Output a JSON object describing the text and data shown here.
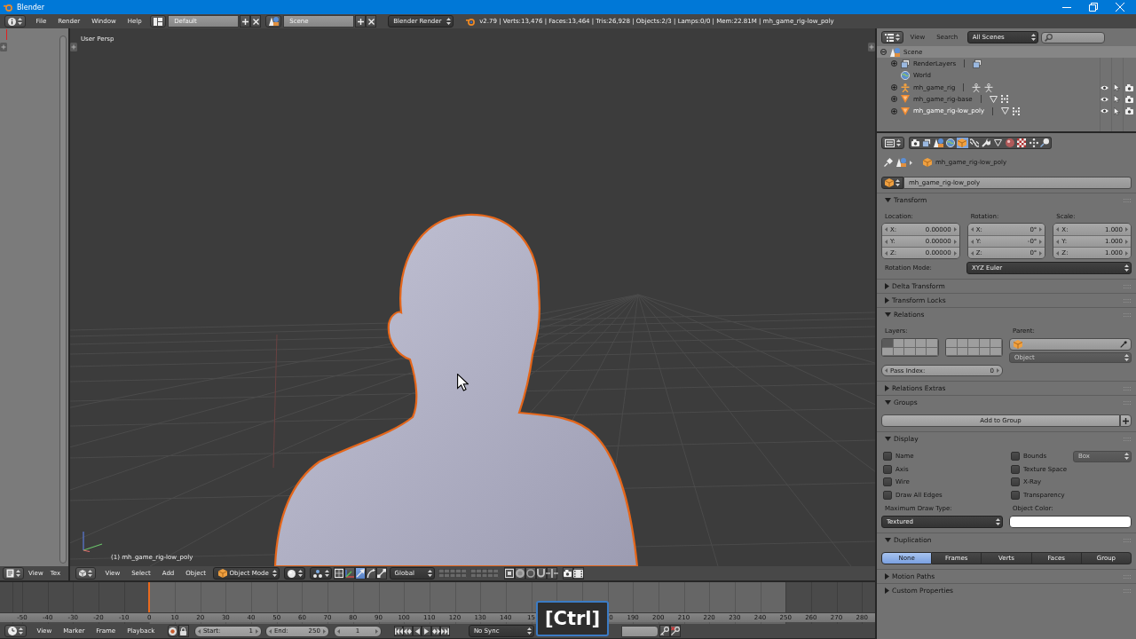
{
  "window": {
    "title": "Blender"
  },
  "info_header": {
    "menus": [
      "File",
      "Render",
      "Window",
      "Help"
    ],
    "layout": "Default",
    "scene": "Scene",
    "engine": "Blender Render",
    "stats": "v2.79 | Verts:13,476 | Faces:13,464 | Tris:26,928 | Objects:2/3 | Lamps:0/0 | Mem:22.81M | mh_game_rig-low_poly"
  },
  "text_editor": {
    "menus": [
      "View",
      "Tex"
    ]
  },
  "viewport": {
    "view_label": "User Persp",
    "object_label": "(1) mh_game_rig-low_poly",
    "menus": [
      "View",
      "Select",
      "Add",
      "Object"
    ],
    "mode": "Object Mode",
    "transform_tools": [
      {
        "kind": "translate",
        "selected": true
      },
      {
        "kind": "rotate",
        "selected": false
      },
      {
        "kind": "scale",
        "selected": false
      }
    ],
    "orientation": "Global"
  },
  "timeline": {
    "ruler_before": [
      "-50",
      "-40",
      "-30",
      "-20",
      "-10",
      "0",
      "10",
      "20",
      "30",
      "40",
      "50",
      "60",
      "70",
      "80",
      "90",
      "100",
      "110",
      "120",
      "130",
      "140",
      "15"
    ],
    "ruler_after": [
      "0",
      "190",
      "200",
      "210",
      "220",
      "230",
      "240",
      "250",
      "260",
      "270",
      "280"
    ],
    "menus": [
      "View",
      "Marker",
      "Frame",
      "Playback"
    ],
    "start_label": "Start:",
    "start": "1",
    "end_label": "End:",
    "end": "250",
    "frame": "1",
    "sync": "No Sync"
  },
  "key_overlay": "[Ctrl]",
  "outliner": {
    "menus": [
      "View",
      "Search"
    ],
    "filter": "All Scenes",
    "tree": [
      {
        "label": "Scene",
        "kind": "scene",
        "expanded": true,
        "selected": true,
        "active": false,
        "children": [
          {
            "label": "RenderLayers",
            "kind": "render_layers",
            "expanded": false,
            "selected": false,
            "active": false
          },
          {
            "label": "World",
            "kind": "world",
            "selected": false,
            "active": false
          },
          {
            "label": "mh_game_rig",
            "kind": "armature",
            "expanded": false,
            "selected": false,
            "active": false
          },
          {
            "label": "mh_game_rig-base",
            "kind": "mesh",
            "expanded": false,
            "selected": false,
            "active": false
          },
          {
            "label": "mh_game_rig-low_poly",
            "kind": "mesh",
            "expanded": false,
            "selected": false,
            "active": true
          }
        ]
      }
    ]
  },
  "properties": {
    "tabs": [
      {
        "kind": "render",
        "selected": false
      },
      {
        "kind": "render_layers",
        "selected": false
      },
      {
        "kind": "scene",
        "selected": false
      },
      {
        "kind": "world",
        "selected": false
      },
      {
        "kind": "object",
        "selected": true
      },
      {
        "kind": "constraints",
        "selected": false
      },
      {
        "kind": "modifiers",
        "selected": false
      },
      {
        "kind": "data",
        "selected": false
      },
      {
        "kind": "material",
        "selected": false
      },
      {
        "kind": "texture",
        "selected": false
      },
      {
        "kind": "particles",
        "selected": false
      },
      {
        "kind": "physics",
        "selected": false
      }
    ],
    "breadcrumb": "mh_game_rig-low_poly",
    "object_name": "mh_game_rig-low_poly",
    "panels": [
      {
        "kind": "transform",
        "title": "Transform",
        "expanded": true,
        "groups": [
          {
            "label": "Location:",
            "fields": [
              {
                "axis": "X:",
                "value": "0.00000"
              },
              {
                "axis": "Y:",
                "value": "0.00000"
              },
              {
                "axis": "Z:",
                "value": "0.00000"
              }
            ]
          },
          {
            "label": "Rotation:",
            "fields": [
              {
                "axis": "X:",
                "value": "0°"
              },
              {
                "axis": "Y:",
                "value": "-0°"
              },
              {
                "axis": "Z:",
                "value": "0°"
              }
            ]
          },
          {
            "label": "Scale:",
            "fields": [
              {
                "axis": "X:",
                "value": "1.000"
              },
              {
                "axis": "Y:",
                "value": "1.000"
              },
              {
                "axis": "Z:",
                "value": "1.000"
              }
            ]
          }
        ],
        "mode_label": "Rotation Mode:",
        "mode": "XYZ Euler"
      },
      {
        "kind": "plain",
        "title": "Delta Transform",
        "expanded": false
      },
      {
        "kind": "plain",
        "title": "Transform Locks",
        "expanded": false
      },
      {
        "kind": "relations",
        "title": "Relations",
        "expanded": true,
        "layers_label": "Layers:",
        "layers": [
          {
            "on": true
          },
          {
            "on": false
          },
          {
            "on": false
          },
          {
            "on": false
          },
          {
            "on": false
          },
          {
            "on": false
          },
          {
            "on": false
          },
          {
            "on": false
          },
          {
            "on": false
          },
          {
            "on": false
          },
          {
            "on": false
          },
          {
            "on": false
          },
          {
            "on": false
          },
          {
            "on": false
          },
          {
            "on": false
          },
          {
            "on": false
          },
          {
            "on": false
          },
          {
            "on": false
          },
          {
            "on": false
          },
          {
            "on": false
          }
        ],
        "parent_label": "Parent:",
        "parent_type": {
          "label": "Object",
          "disabled": true
        },
        "pass_label": "Pass Index:",
        "pass_index": "0"
      },
      {
        "kind": "plain",
        "title": "Relations Extras",
        "expanded": false
      },
      {
        "kind": "groups",
        "title": "Groups",
        "expanded": true,
        "button": "Add to Group"
      },
      {
        "kind": "display",
        "title": "Display",
        "expanded": true,
        "left": [
          {
            "label": "Name",
            "checked": false
          },
          {
            "label": "Axis",
            "checked": false
          },
          {
            "label": "Wire",
            "checked": false
          },
          {
            "label": "Draw All Edges",
            "checked": false
          }
        ],
        "right": [
          {
            "label": "Bounds",
            "checked": false
          },
          {
            "label": "Texture Space",
            "checked": false
          },
          {
            "label": "X-Ray",
            "checked": false
          },
          {
            "label": "Transparency",
            "checked": false
          }
        ],
        "bounds_type": {
          "label": "Box",
          "disabled": true
        },
        "draw_type_label": "Maximum Draw Type:",
        "draw_type": "Textured",
        "color_label": "Object Color:",
        "color": "#ffffff"
      },
      {
        "kind": "duplication",
        "title": "Duplication",
        "expanded": true,
        "options": [
          {
            "label": "None",
            "selected": true
          },
          {
            "label": "Frames",
            "selected": false
          },
          {
            "label": "Verts",
            "selected": false
          },
          {
            "label": "Faces",
            "selected": false
          },
          {
            "label": "Group",
            "selected": false
          }
        ]
      },
      {
        "kind": "plain",
        "title": "Motion Paths",
        "expanded": false
      },
      {
        "kind": "plain",
        "title": "Custom Properties",
        "expanded": false
      }
    ]
  }
}
